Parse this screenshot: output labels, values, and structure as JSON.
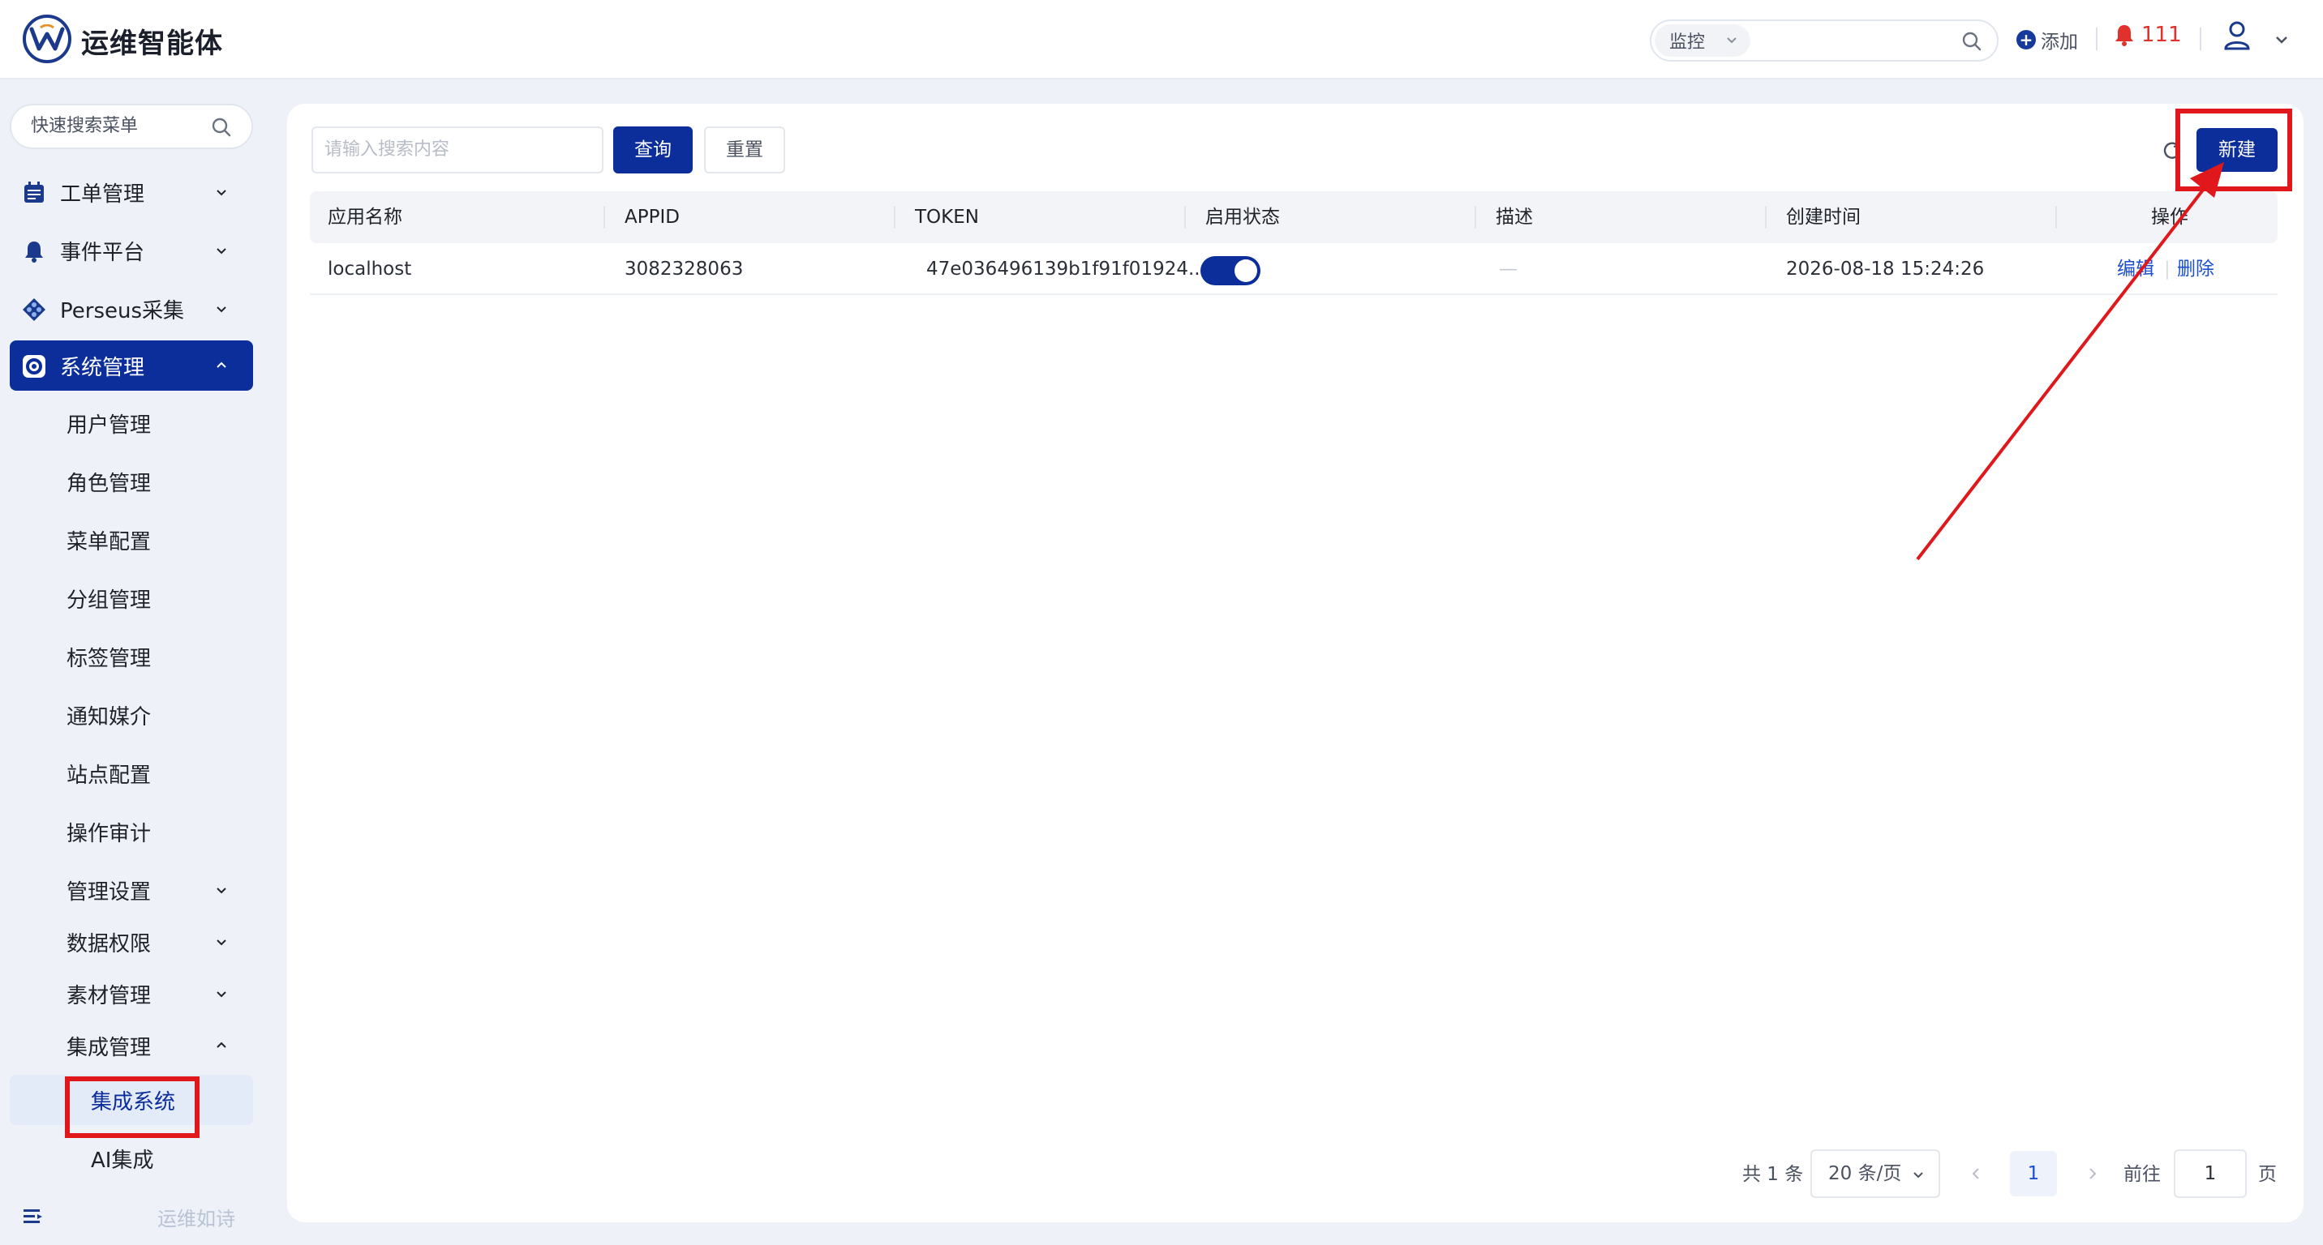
{
  "header": {
    "app_title": "运维智能体",
    "search_scope": "监控",
    "add_label": "添加",
    "notification_count": "111"
  },
  "sidebar": {
    "search_placeholder": "快速搜索菜单",
    "menus": [
      {
        "label": "工单管理",
        "icon": "calendar-icon",
        "expanded": false
      },
      {
        "label": "事件平台",
        "icon": "bell-icon",
        "expanded": false
      },
      {
        "label": "Perseus采集",
        "icon": "diamond-icon",
        "expanded": false
      },
      {
        "label": "系统管理",
        "icon": "gear-icon",
        "expanded": true
      }
    ],
    "sub_items": [
      "用户管理",
      "角色管理",
      "菜单配置",
      "分组管理",
      "标签管理",
      "通知媒介",
      "站点配置",
      "操作审计",
      "管理设置",
      "数据权限",
      "素材管理",
      "集成管理"
    ],
    "integration_children": [
      "集成系统",
      "AI集成"
    ],
    "footer_text": "运维如诗"
  },
  "toolbar": {
    "search_placeholder": "请输入搜索内容",
    "query_label": "查询",
    "reset_label": "重置",
    "new_label": "新建"
  },
  "table": {
    "columns": [
      "应用名称",
      "APPID",
      "TOKEN",
      "启用状态",
      "描述",
      "创建时间",
      "操作"
    ],
    "rows": [
      {
        "name": "localhost",
        "appid": "3082328063",
        "token": "47e036496139b1f91f01924...",
        "enabled": true,
        "description": "—",
        "created": "2026-08-18 15:24:26",
        "actions": [
          "编辑",
          "删除"
        ]
      }
    ]
  },
  "pagination": {
    "total": "共 1 条",
    "page_size": "20 条/页",
    "current_page": "1",
    "goto_label": "前往",
    "goto_value": "1",
    "page_unit": "页"
  },
  "colors": {
    "primary": "#0c2e9b",
    "annotation": "#e0181b",
    "alert": "#e0312d"
  }
}
